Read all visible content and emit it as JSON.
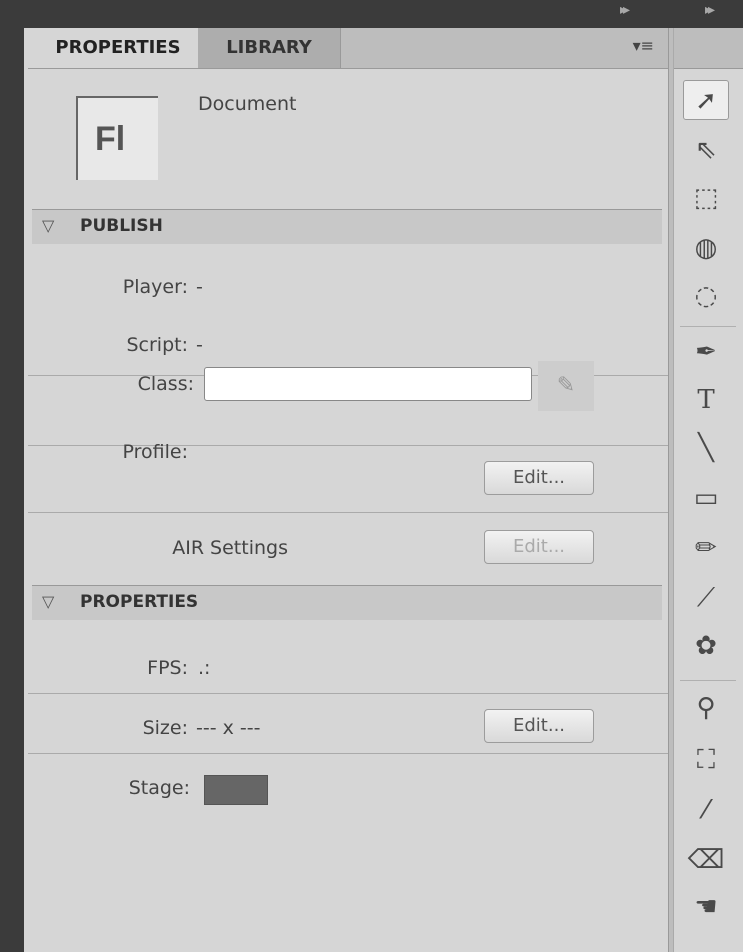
{
  "tabs": {
    "active": "PROPERTIES",
    "inactive": "LIBRARY"
  },
  "panel_menu_icon": "panel-menu-icon",
  "document": {
    "logo_text": "Fl",
    "label": "Document"
  },
  "publish": {
    "header": "PUBLISH",
    "player_label": "Player:",
    "player_value": "-",
    "script_label": "Script:",
    "script_value": "-",
    "class_label": "Class:",
    "class_value": "",
    "profile_label": "Profile:",
    "profile_edit": "Edit...",
    "air_label": "AIR Settings",
    "air_edit": "Edit..."
  },
  "properties": {
    "header": "PROPERTIES",
    "fps_label": "FPS:",
    "fps_value": ".:",
    "size_label": "Size:",
    "size_value": "--- x ---",
    "size_edit": "Edit...",
    "stage_label": "Stage:",
    "stage_color": "#666666"
  },
  "tools": [
    "selection-tool-icon",
    "subselection-tool-icon",
    "free-transform-tool-icon",
    "3d-rotation-tool-icon",
    "lasso-tool-icon",
    "pen-tool-icon",
    "text-tool-icon",
    "line-tool-icon",
    "rectangle-tool-icon",
    "pencil-tool-icon",
    "brush-tool-icon",
    "deco-tool-icon",
    "bone-tool-icon",
    "paint-bucket-tool-icon",
    "eyedropper-tool-icon",
    "eraser-tool-icon",
    "hand-tool-icon"
  ]
}
